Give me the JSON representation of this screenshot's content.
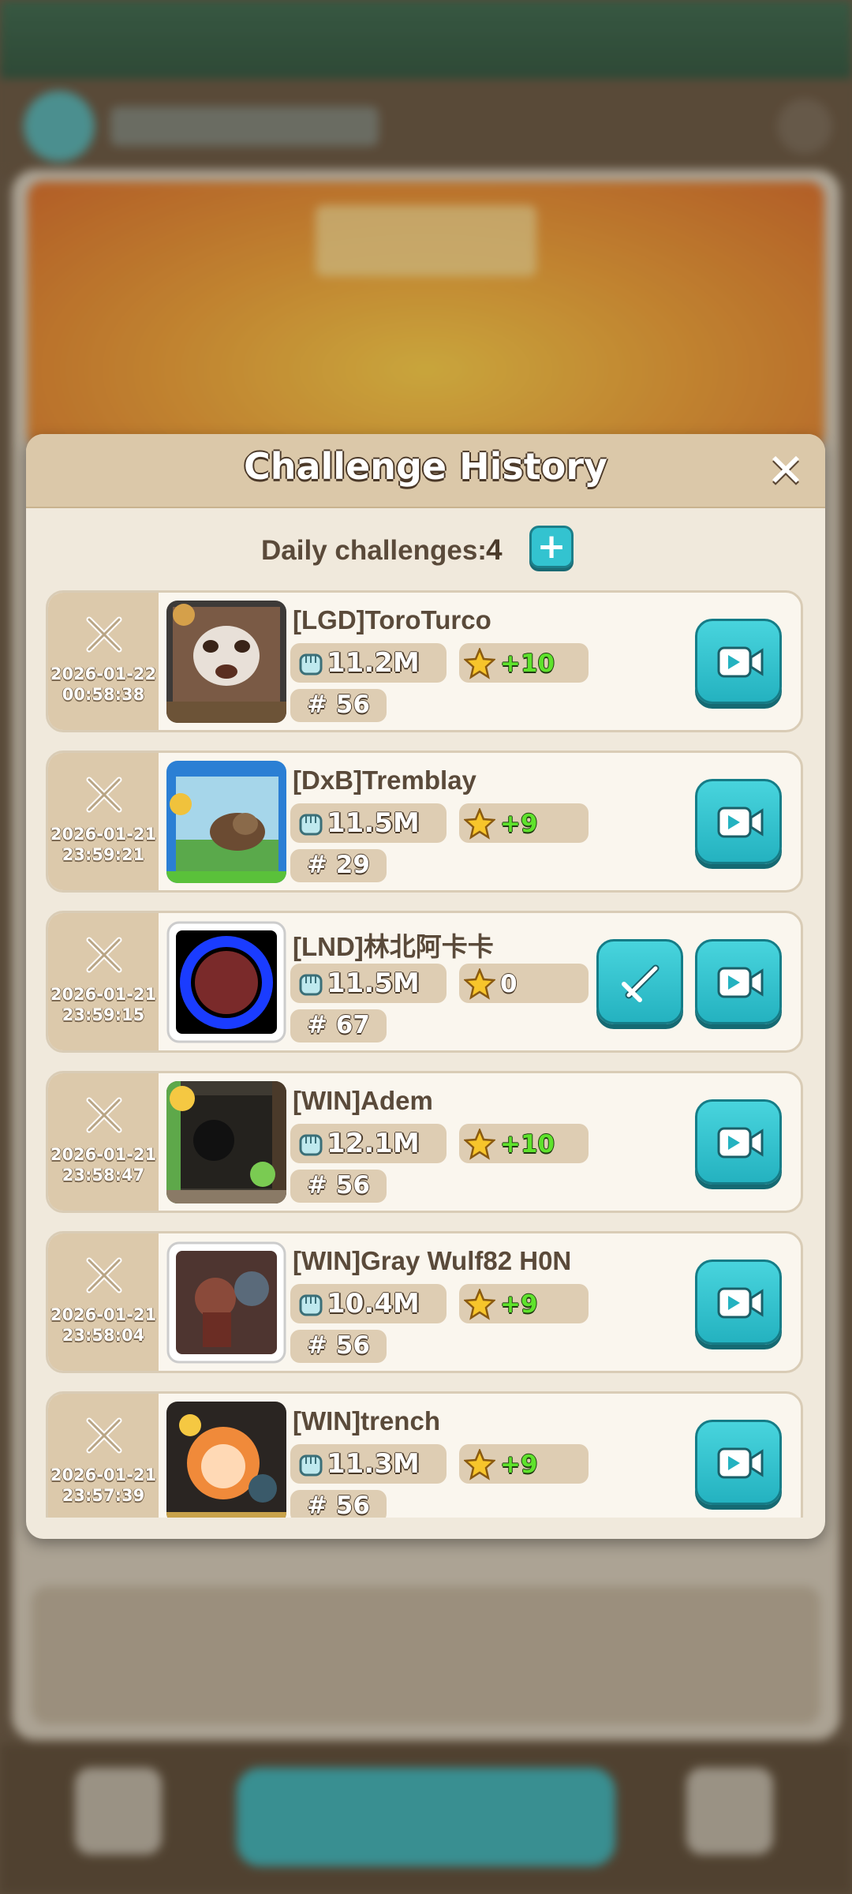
{
  "dialog": {
    "title": "Challenge History",
    "close_icon": "close-icon",
    "daily_label": "Daily challenges:",
    "daily_count": "4",
    "add_label": "+"
  },
  "rows": [
    {
      "date": "2026-01-22",
      "time": "00:58:38",
      "name": "[LGD]ToroTurco",
      "power": "11.2M",
      "points": "+10",
      "rank": "# 56",
      "attack": false
    },
    {
      "date": "2026-01-21",
      "time": "23:59:21",
      "name": "[DxB]Tremblay",
      "power": "11.5M",
      "points": "+9",
      "rank": "# 29",
      "attack": false
    },
    {
      "date": "2026-01-21",
      "time": "23:59:15",
      "name": "[LND]林北阿卡卡",
      "power": "11.5M",
      "points": "0",
      "rank": "# 67",
      "attack": true
    },
    {
      "date": "2026-01-21",
      "time": "23:58:47",
      "name": "[WIN]Adem",
      "power": "12.1M",
      "points": "+10",
      "rank": "# 56",
      "attack": false
    },
    {
      "date": "2026-01-21",
      "time": "23:58:04",
      "name": "[WIN]Gray Wulf82 H0N",
      "power": "10.4M",
      "points": "+9",
      "rank": "# 56",
      "attack": false
    },
    {
      "date": "2026-01-21",
      "time": "23:57:39",
      "name": "[WIN]trench",
      "power": "11.3M",
      "points": "+9",
      "rank": "# 56",
      "attack": false
    }
  ],
  "colors": {
    "accent": "#33c3d0",
    "header": "#dbc8a9",
    "panel": "#f0e9dc",
    "points_green": "#5fe22c"
  }
}
